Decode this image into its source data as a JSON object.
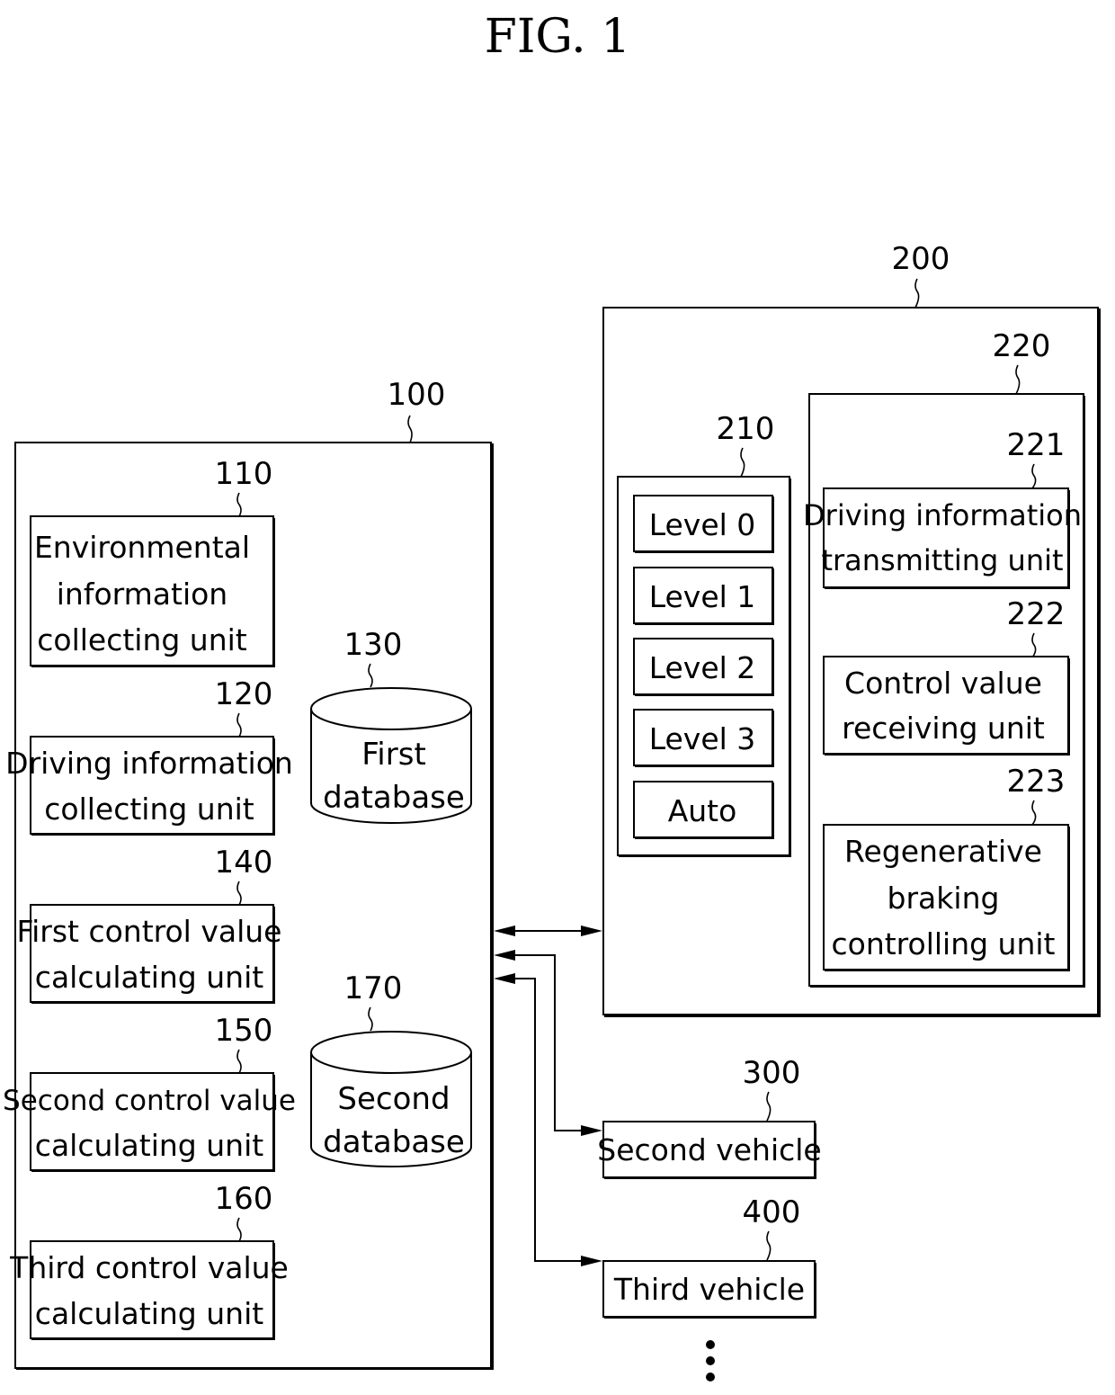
{
  "figure": {
    "title": "FIG. 1"
  },
  "server": {
    "ref": "100",
    "units": [
      {
        "ref": "110",
        "lines": [
          "Environmental",
          "information",
          "collecting unit"
        ]
      },
      {
        "ref": "120",
        "lines": [
          "Driving information",
          "collecting unit"
        ]
      },
      {
        "ref": "140",
        "lines": [
          "First control value",
          "calculating unit"
        ]
      },
      {
        "ref": "150",
        "lines": [
          "Second control value",
          "calculating unit"
        ]
      },
      {
        "ref": "160",
        "lines": [
          "Third control value",
          "calculating unit"
        ]
      }
    ],
    "databases": [
      {
        "ref": "130",
        "lines": [
          "First",
          "database"
        ]
      },
      {
        "ref": "170",
        "lines": [
          "Second",
          "database"
        ]
      }
    ]
  },
  "vehicle": {
    "ref": "200",
    "level_selector": {
      "ref": "210",
      "levels": [
        "Level 0",
        "Level 1",
        "Level 2",
        "Level 3",
        "Auto"
      ]
    },
    "controller": {
      "ref": "220",
      "units": [
        {
          "ref": "221",
          "lines": [
            "Driving information",
            "transmitting unit"
          ]
        },
        {
          "ref": "222",
          "lines": [
            "Control value",
            "receiving unit"
          ]
        },
        {
          "ref": "223",
          "lines": [
            "Regenerative",
            "braking",
            "controlling unit"
          ]
        }
      ]
    }
  },
  "other_vehicles": [
    {
      "ref": "300",
      "label": "Second vehicle"
    },
    {
      "ref": "400",
      "label": "Third vehicle"
    }
  ],
  "continuation": "more-vehicles-ellipsis"
}
